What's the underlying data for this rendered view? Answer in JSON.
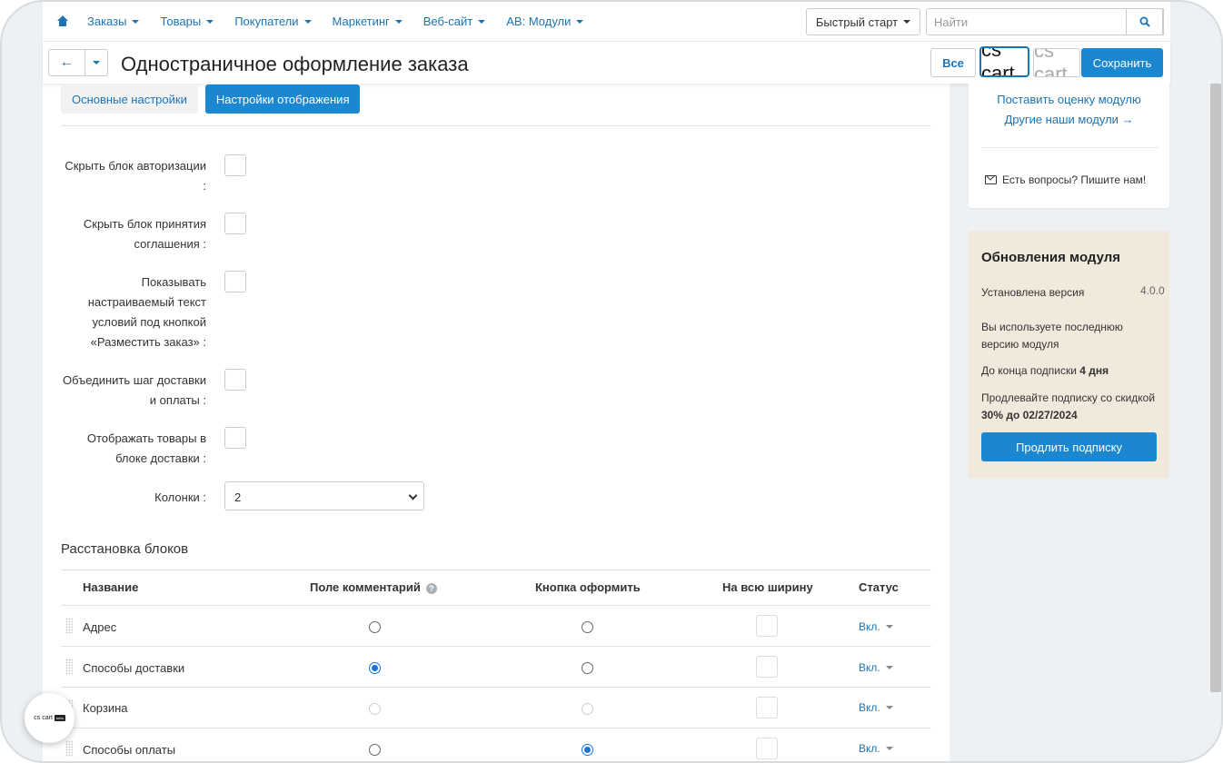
{
  "nav": {
    "menu": [
      "Заказы",
      "Товары",
      "Покупатели",
      "Маркетинг",
      "Веб-сайт",
      "AB: Модули"
    ],
    "quick_start": "Быстрый старт",
    "search_placeholder": "Найти"
  },
  "titlebar": {
    "title": "Одностраничное оформление заказа",
    "all_label": "Все",
    "logo_text": "cs cart",
    "save_label": "Сохранить"
  },
  "tabs": [
    {
      "label": "Основные настройки",
      "active": false
    },
    {
      "label": "Настройки отображения",
      "active": true
    }
  ],
  "form": {
    "fields": [
      {
        "label": "Скрыть блок авторизации :",
        "checked": false
      },
      {
        "label": "Скрыть блок принятия соглашения :",
        "checked": false
      },
      {
        "label": "Показывать настраиваемый текст условий под кнопкой «Разместить заказ» :",
        "checked": false
      },
      {
        "label": "Объединить шаг доставки и оплаты :",
        "checked": false
      },
      {
        "label": "Отображать товары в блоке доставки :",
        "checked": false
      }
    ],
    "columns_label": "Колонки :",
    "columns_value": "2"
  },
  "blocks": {
    "section_title": "Расстановка блоков",
    "headers": [
      "Название",
      "Поле комментарий",
      "Кнопка оформить",
      "На всю ширину",
      "Статус"
    ],
    "rows": [
      {
        "name": "Адрес",
        "comment": "unchecked",
        "submit": "unchecked",
        "status": "Вкл."
      },
      {
        "name": "Способы доставки",
        "comment": "checked",
        "submit": "unchecked",
        "status": "Вкл."
      },
      {
        "name": "Корзина",
        "comment": "disabled",
        "submit": "disabled",
        "status": "Вкл."
      },
      {
        "name": "Способы оплаты",
        "comment": "unchecked",
        "submit": "checked",
        "status": "Вкл."
      }
    ]
  },
  "sidebar": {
    "rate_link": "Поставить оценку модулю",
    "other_link": "Другие наши модули →",
    "contact": "Есть вопросы? Пишите нам!",
    "updates": {
      "title": "Обновления модуля",
      "installed_label": "Установлена версия",
      "installed_version": "4.0.0",
      "latest_msg": "Вы используете последнюю версию модуля",
      "sub_prefix": "До конца подписки ",
      "sub_days": "4 дня",
      "renew_prefix": "Продлевайте подписку со скидкой ",
      "renew_bold": "30% до 02/27/2024",
      "renew_button": "Продлить подписку"
    }
  },
  "float_logo": {
    "text": "cs cart",
    "tag": "beta"
  }
}
